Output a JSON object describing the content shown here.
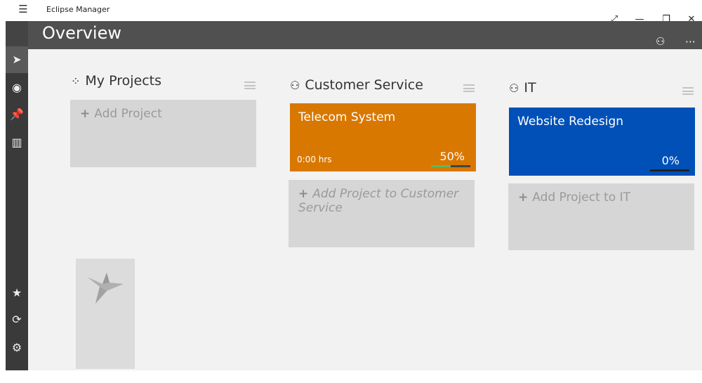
{
  "window": {
    "menu_icon": "hamburger-icon",
    "title": "Eclipse Manager",
    "controls": [
      "expand-icon",
      "minimize-icon",
      "restore-icon",
      "close-icon"
    ]
  },
  "sidebar": {
    "top_items": [
      "bird-icon",
      "record-icon",
      "pin-icon",
      "chart-icon"
    ],
    "bottom_items": [
      "star-icon",
      "sync-icon",
      "settings-icon"
    ]
  },
  "header": {
    "title": "Overview",
    "icons": [
      "team-icon",
      "more-icon"
    ]
  },
  "columns": [
    {
      "title": "My Projects",
      "icon": "grid-icon",
      "add_label": "Add Project",
      "add_italic": false,
      "projects": []
    },
    {
      "title": "Customer Service",
      "icon": "team-icon",
      "add_label": "Add Project to Customer Service",
      "add_italic": true,
      "projects": [
        {
          "name": "Telecom System",
          "hours": "0:00 hrs",
          "percent": "50%",
          "progress": 0.5,
          "color": "#d97800"
        }
      ]
    },
    {
      "title": "IT",
      "icon": "team-icon",
      "add_label": "Add Project to IT",
      "add_italic": false,
      "projects": [
        {
          "name": "Website Redesign",
          "hours": "",
          "percent": "0%",
          "progress": 0,
          "color": "#0050b8"
        }
      ]
    }
  ],
  "colors": {
    "sidebar": "#3a3a3a",
    "header": "#505050",
    "content": "#f2f2f2",
    "add_card": "#d6d6d6"
  }
}
